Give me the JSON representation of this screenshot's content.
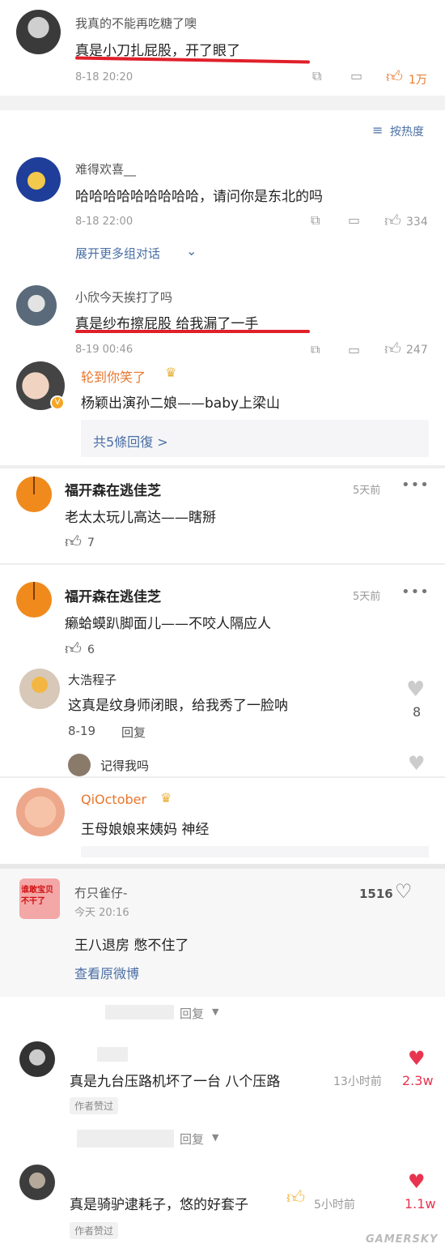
{
  "c1": {
    "name": "我真的不能再吃糖了噢",
    "text": "真是小刀扎屁股，开了眼了",
    "time": "8-18 20:20",
    "likes": "1万"
  },
  "sort": {
    "label": "按热度"
  },
  "c2": {
    "name": "难得欢喜__",
    "text": "哈哈哈哈哈哈哈哈哈，请问你是东北的吗",
    "time": "8-18 22:00",
    "likes": "334",
    "expand": "展开更多组对话"
  },
  "c3": {
    "name": "小欣今天挨打了吗",
    "text": "真是纱布擦屁股 给我漏了一手",
    "time": "8-19 00:46",
    "likes": "247"
  },
  "c4": {
    "name": "轮到你笑了",
    "text": "杨颖出演孙二娘——baby上梁山",
    "replies": "共5條回復 >"
  },
  "c5": {
    "name": "福开森在逃佳芝",
    "time": "5天前",
    "text": "老太太玩儿高达——瞎掰",
    "likes": "7"
  },
  "c6": {
    "name": "福开森在逃佳芝",
    "time": "5天前",
    "text": "癞蛤蟆趴脚面儿——不咬人隔应人",
    "likes": "6"
  },
  "c7": {
    "name": "大浩程子",
    "text": "这真是纹身师闭眼，给我秀了一脸呐",
    "time": "8-19",
    "reply": "回复",
    "likes": "8"
  },
  "c8": {
    "name": "记得我吗"
  },
  "c9": {
    "name": "QiOctober",
    "text": "王母娘娘来姨妈 神经"
  },
  "c10": {
    "name": "冇只雀仔-",
    "time": "今天 20:16",
    "text": "王八退房 憋不住了",
    "likes": "1516",
    "link": "查看原微博",
    "avatar_text": "谁敢宝贝不干了",
    "more": "回复"
  },
  "c11": {
    "text": "真是九台压路机坏了一台 八个压路",
    "time": "13小时前",
    "likes": "2.3w",
    "tag": "作者赞过",
    "more": "回复"
  },
  "c12": {
    "text": "真是骑驴逮耗子，悠的好套子",
    "time": "5小时前",
    "likes": "1.1w",
    "tag": "作者赞过"
  },
  "watermark": "GAMERSKY"
}
